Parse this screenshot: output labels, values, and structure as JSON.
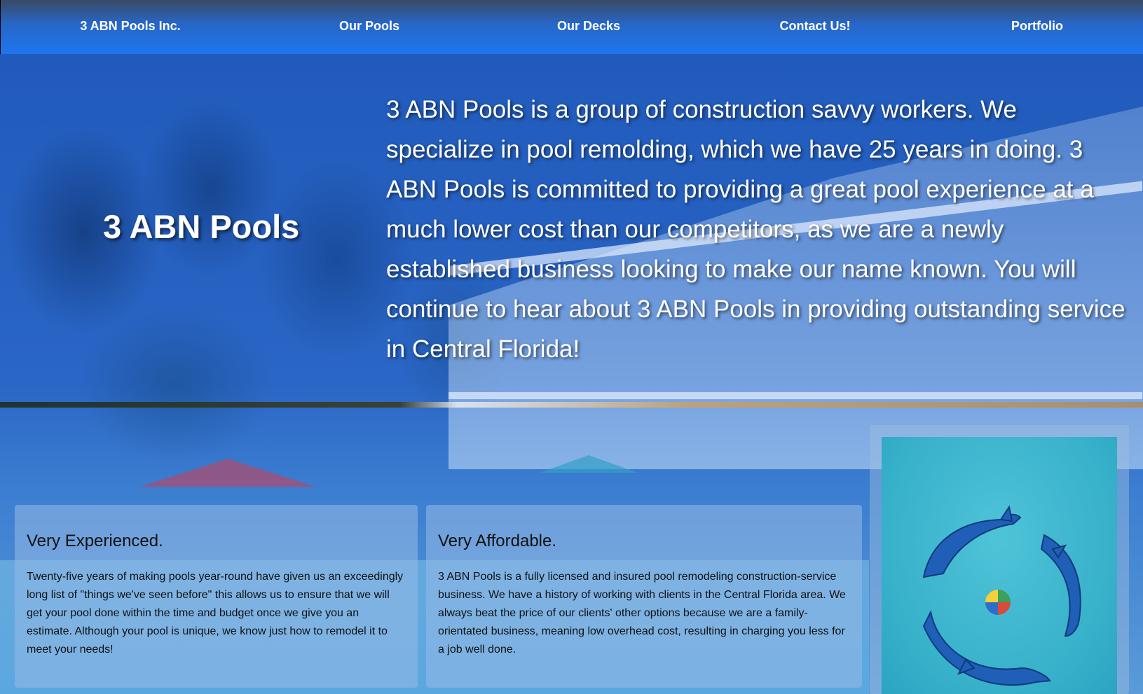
{
  "nav": {
    "brand": "3 ABN Pools Inc.",
    "items": [
      "Our Pools",
      "Our Decks",
      "Contact Us!",
      "Portfolio"
    ]
  },
  "hero": {
    "title": "3 ABN Pools",
    "text": "3 ABN Pools is a group of construction savvy workers. We specialize in pool remolding, which we have 25 years in doing. 3 ABN Pools is committed to providing a great pool experience at a much lower cost than our competitors, as we are a newly established business looking to make our name known. You will continue to hear about 3 ABN Pools in providing outstanding service in Central Florida!"
  },
  "cards": [
    {
      "heading": "Very Experienced.",
      "body": "Twenty-five years of making pools year-round have given us an exceedingly long list of \"things we've seen before\" this allows us to ensure that we will get your pool done within the time and budget once we give you an estimate. Although your pool is unique, we know just how to remodel it to meet your needs!"
    },
    {
      "heading": "Very Affordable.",
      "body": "3 ABN Pools is a fully licensed and insured pool remodeling construction-service business. We have a history of working with clients in the Central Florida area. We always beat the price of our clients' other options because we are a family-orientated business, meaning low overhead cost, resulting in charging you less for a job well done."
    }
  ],
  "image": {
    "icon": "dolphin-mosaic-icon"
  }
}
